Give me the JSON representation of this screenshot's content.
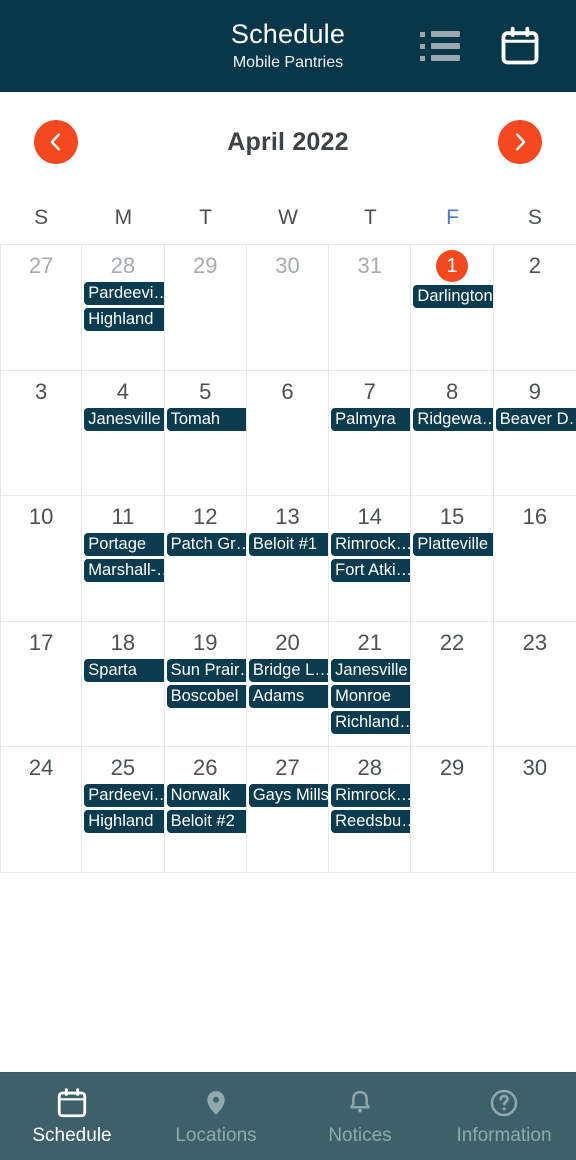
{
  "header": {
    "title": "Schedule",
    "subtitle": "Mobile Pantries",
    "list_icon": "list-view-icon",
    "calendar_icon": "calendar-view-icon",
    "background_color": "#09374a"
  },
  "month_nav": {
    "prev_label": "chevron-left-icon",
    "next_label": "chevron-right-icon",
    "month_label": "April 2022",
    "accent_color": "#f4481f"
  },
  "weekdays": [
    {
      "label": "S",
      "highlight": false
    },
    {
      "label": "M",
      "highlight": false
    },
    {
      "label": "T",
      "highlight": false
    },
    {
      "label": "W",
      "highlight": false
    },
    {
      "label": "T",
      "highlight": false
    },
    {
      "label": "F",
      "highlight": true
    },
    {
      "label": "S",
      "highlight": false
    }
  ],
  "weekday_highlight_color": "#5178cd",
  "event_chip_color": "#0b3b4e",
  "calendar": {
    "weeks": [
      [
        {
          "day": "27",
          "other_month": true,
          "today": false,
          "events": []
        },
        {
          "day": "28",
          "other_month": true,
          "today": false,
          "events": [
            "Pardeevi…",
            "Highland"
          ]
        },
        {
          "day": "29",
          "other_month": true,
          "today": false,
          "events": []
        },
        {
          "day": "30",
          "other_month": true,
          "today": false,
          "events": []
        },
        {
          "day": "31",
          "other_month": true,
          "today": false,
          "events": []
        },
        {
          "day": "1",
          "other_month": false,
          "today": true,
          "events": [
            "Darlington"
          ]
        },
        {
          "day": "2",
          "other_month": false,
          "today": false,
          "events": []
        }
      ],
      [
        {
          "day": "3",
          "other_month": false,
          "today": false,
          "events": []
        },
        {
          "day": "4",
          "other_month": false,
          "today": false,
          "events": [
            "Janesville"
          ]
        },
        {
          "day": "5",
          "other_month": false,
          "today": false,
          "events": [
            "Tomah"
          ]
        },
        {
          "day": "6",
          "other_month": false,
          "today": false,
          "events": []
        },
        {
          "day": "7",
          "other_month": false,
          "today": false,
          "events": [
            "Palmyra"
          ]
        },
        {
          "day": "8",
          "other_month": false,
          "today": false,
          "events": [
            "Ridgewa…"
          ]
        },
        {
          "day": "9",
          "other_month": false,
          "today": false,
          "events": [
            "Beaver D…"
          ]
        }
      ],
      [
        {
          "day": "10",
          "other_month": false,
          "today": false,
          "events": []
        },
        {
          "day": "11",
          "other_month": false,
          "today": false,
          "events": [
            "Portage",
            "Marshall-…"
          ]
        },
        {
          "day": "12",
          "other_month": false,
          "today": false,
          "events": [
            "Patch Gr…"
          ]
        },
        {
          "day": "13",
          "other_month": false,
          "today": false,
          "events": [
            "Beloit #1"
          ]
        },
        {
          "day": "14",
          "other_month": false,
          "today": false,
          "events": [
            "Rimrock…",
            "Fort Atki…"
          ]
        },
        {
          "day": "15",
          "other_month": false,
          "today": false,
          "events": [
            "Platteville"
          ]
        },
        {
          "day": "16",
          "other_month": false,
          "today": false,
          "events": []
        }
      ],
      [
        {
          "day": "17",
          "other_month": false,
          "today": false,
          "events": []
        },
        {
          "day": "18",
          "other_month": false,
          "today": false,
          "events": [
            "Sparta"
          ]
        },
        {
          "day": "19",
          "other_month": false,
          "today": false,
          "events": [
            "Sun Prair…",
            "Boscobel"
          ]
        },
        {
          "day": "20",
          "other_month": false,
          "today": false,
          "events": [
            "Bridge L…",
            "Adams"
          ]
        },
        {
          "day": "21",
          "other_month": false,
          "today": false,
          "events": [
            "Janesville",
            "Monroe",
            "Richland…"
          ]
        },
        {
          "day": "22",
          "other_month": false,
          "today": false,
          "events": []
        },
        {
          "day": "23",
          "other_month": false,
          "today": false,
          "events": []
        }
      ],
      [
        {
          "day": "24",
          "other_month": false,
          "today": false,
          "events": []
        },
        {
          "day": "25",
          "other_month": false,
          "today": false,
          "events": [
            "Pardeevi…",
            "Highland"
          ]
        },
        {
          "day": "26",
          "other_month": false,
          "today": false,
          "events": [
            "Norwalk",
            "Beloit #2"
          ]
        },
        {
          "day": "27",
          "other_month": false,
          "today": false,
          "events": [
            "Gays Mills"
          ]
        },
        {
          "day": "28",
          "other_month": false,
          "today": false,
          "events": [
            "Rimrock…",
            "Reedsbu…"
          ]
        },
        {
          "day": "29",
          "other_month": false,
          "today": false,
          "events": []
        },
        {
          "day": "30",
          "other_month": false,
          "today": false,
          "events": []
        }
      ]
    ]
  },
  "bottom_nav": {
    "background_color": "#3d6069",
    "items": [
      {
        "label": "Schedule",
        "icon": "calendar-icon",
        "active": true
      },
      {
        "label": "Locations",
        "icon": "map-pin-icon",
        "active": false
      },
      {
        "label": "Notices",
        "icon": "bell-icon",
        "active": false
      },
      {
        "label": "Information",
        "icon": "question-mark-icon",
        "active": false
      }
    ]
  }
}
